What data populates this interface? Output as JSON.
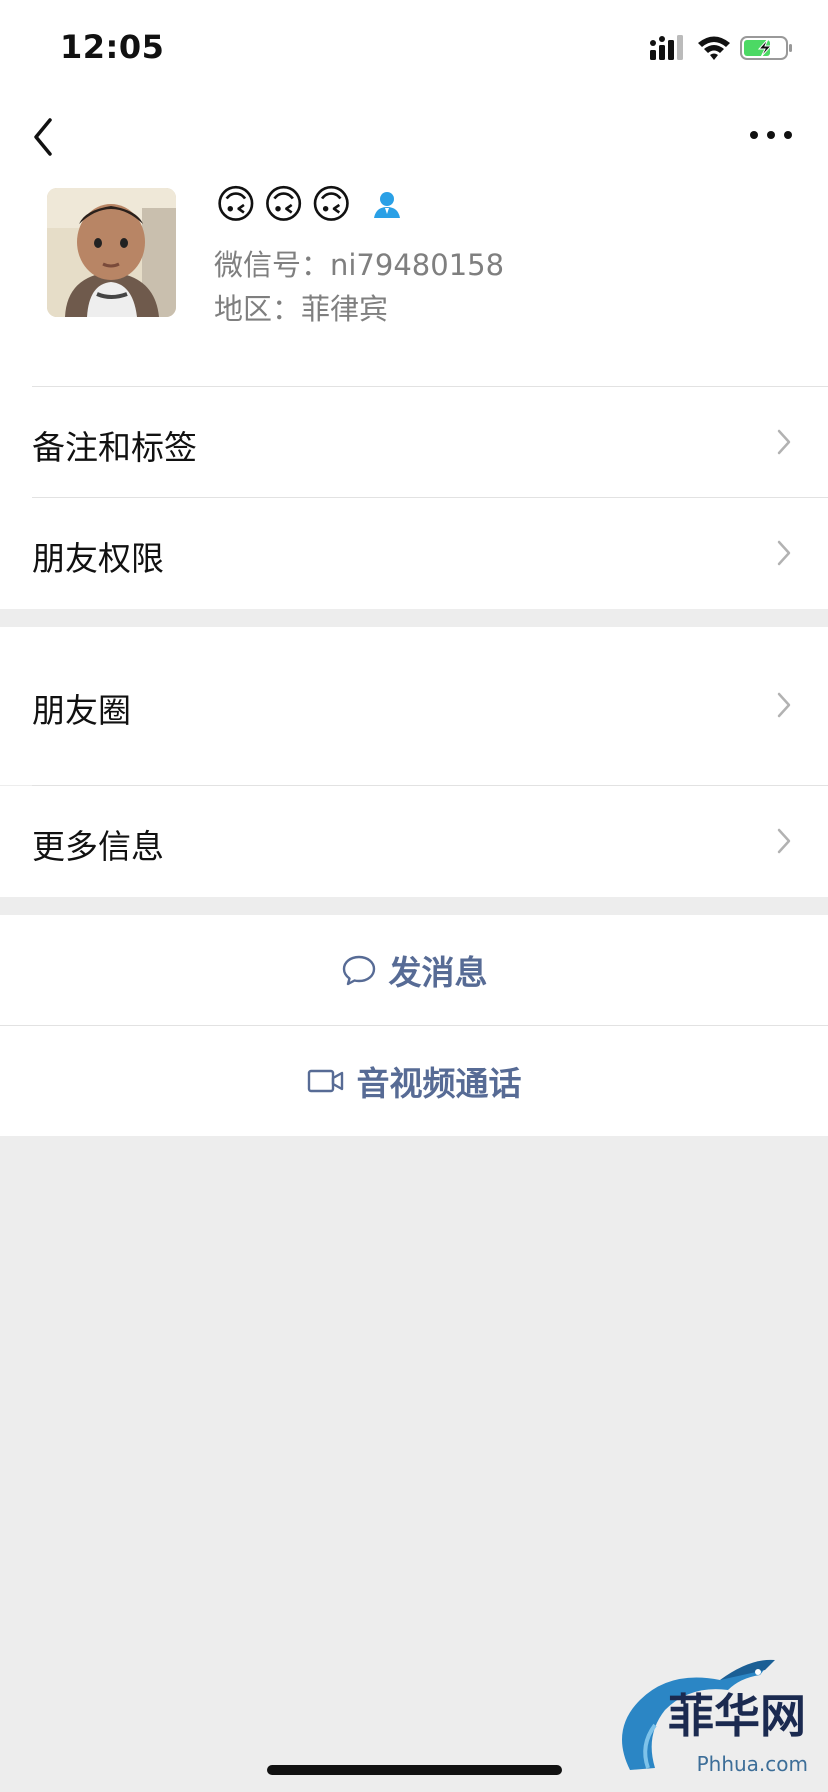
{
  "status_bar": {
    "time": "12:05"
  },
  "profile": {
    "nickname_emojis": [
      "🙃",
      "🙃",
      "🙃"
    ],
    "wechat_id": "微信号：ni79480158",
    "region": "地区：菲律宾"
  },
  "menu": {
    "remarks_tags": "备注和标签",
    "friend_permissions": "朋友权限",
    "moments": "朋友圈",
    "more_info": "更多信息"
  },
  "actions": {
    "send_message": "发消息",
    "video_call": "音视频通话"
  },
  "watermark": {
    "cn": "菲华网",
    "domain": "Phhua.com"
  },
  "colors": {
    "link_blue": "#576b95",
    "badge_blue": "#2aa0e6",
    "battery_green": "#4cd964",
    "page_gray": "#ededed"
  }
}
